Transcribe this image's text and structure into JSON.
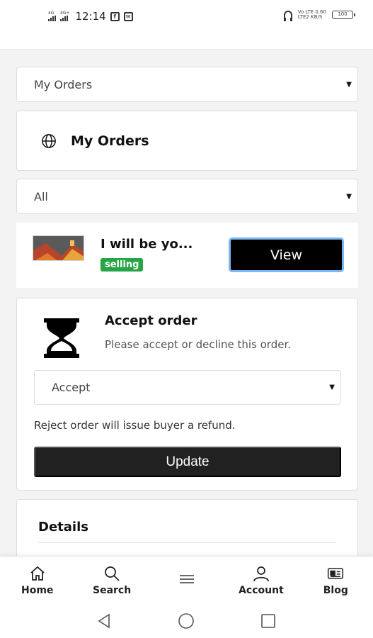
{
  "status_bar": {
    "signal1_label": "4G",
    "signal2_label": "4G+",
    "time": "12:14",
    "net_speed_top": "Vo LTE 0.60",
    "net_speed_bottom": "LTE2 KB/S",
    "battery_level": "100"
  },
  "page_select": {
    "value": "My Orders"
  },
  "header": {
    "title": "My Orders",
    "icon": "globe-icon"
  },
  "filter_select": {
    "value": "All"
  },
  "order": {
    "name": "I will be yo...",
    "badge": "selling",
    "badge_color": "#26a546",
    "view_label": "View"
  },
  "accept_card": {
    "icon": "hourglass-icon",
    "title": "Accept order",
    "subtitle": "Please accept or decline this order.",
    "select_value": "Accept",
    "note": "Reject order will issue buyer a refund.",
    "update_label": "Update"
  },
  "details": {
    "title": "Details"
  },
  "bottom_nav": {
    "items": [
      {
        "label": "Home",
        "icon": "home-icon"
      },
      {
        "label": "Search",
        "icon": "search-icon"
      },
      {
        "label": "",
        "icon": "menu-icon"
      },
      {
        "label": "Account",
        "icon": "account-icon"
      },
      {
        "label": "Blog",
        "icon": "blog-icon"
      }
    ]
  },
  "system_nav": {
    "icons": [
      "back-icon",
      "home-circle-icon",
      "recents-icon"
    ]
  },
  "colors": {
    "accent_button": "#000000",
    "view_button_outline": "#79b7f0",
    "update_button": "#212121",
    "page_background": "#f3f3f3"
  }
}
